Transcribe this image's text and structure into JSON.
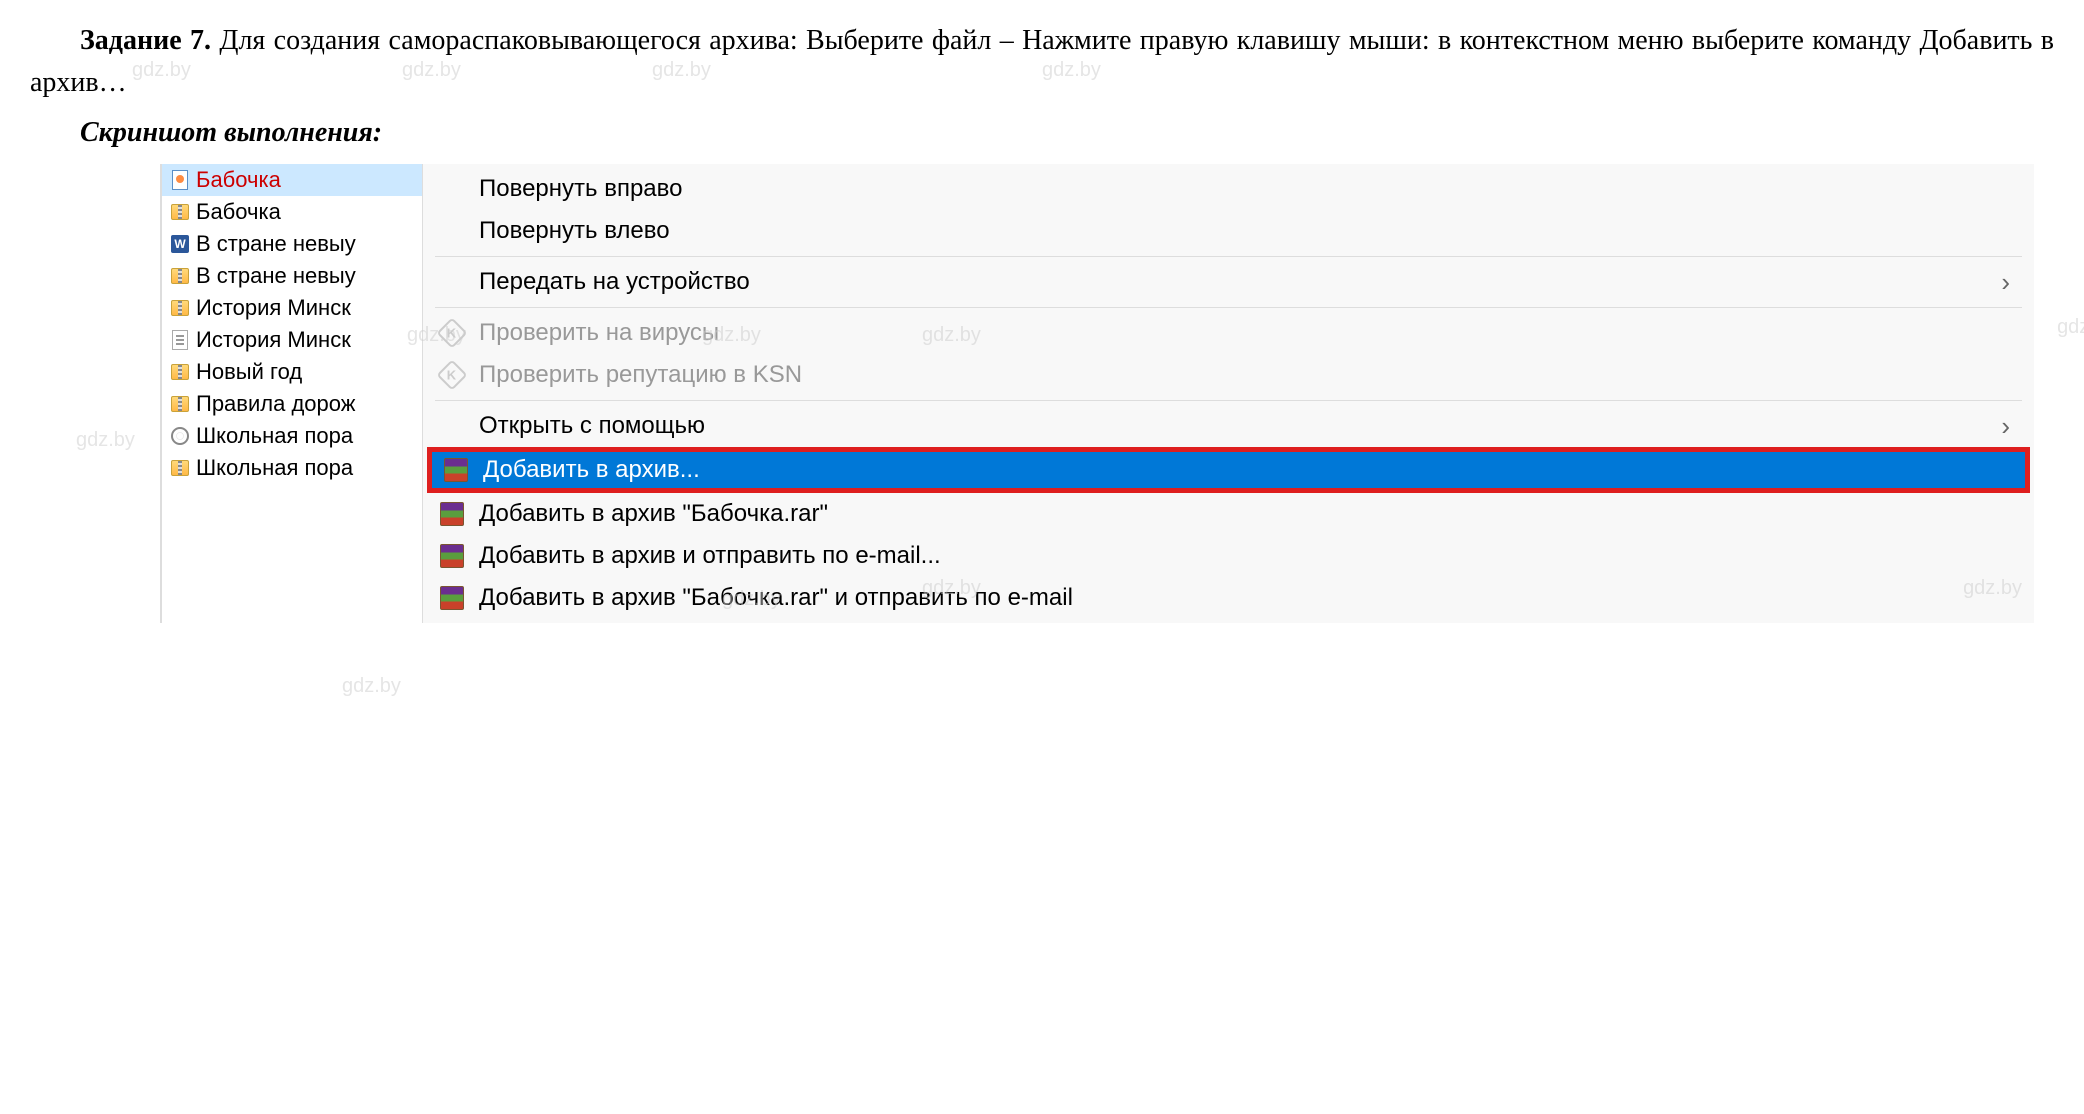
{
  "task": {
    "label": "Задание 7.",
    "text": " Для создания самораспаковывающегося архива: Выберите файл – Нажмите правую клавишу мыши: в контекстном меню выберите команду Добавить в архив…"
  },
  "subtitle": "Скриншот выполнения:",
  "watermark": "gdz.by",
  "files": [
    {
      "name": "Бабочка",
      "icon": "doc-page",
      "selected": true
    },
    {
      "name": "Бабочка",
      "icon": "zip",
      "selected": false
    },
    {
      "name": "В стране невыу",
      "icon": "word",
      "selected": false
    },
    {
      "name": "В стране невыу",
      "icon": "zip",
      "selected": false
    },
    {
      "name": "История Минск",
      "icon": "zip",
      "selected": false
    },
    {
      "name": "История Минск",
      "icon": "text",
      "selected": false
    },
    {
      "name": "Новый год",
      "icon": "zip",
      "selected": false
    },
    {
      "name": "Правила дорож",
      "icon": "zip",
      "selected": false
    },
    {
      "name": "Школьная пора",
      "icon": "disc",
      "selected": false
    },
    {
      "name": "Школьная пора",
      "icon": "zip",
      "selected": false
    }
  ],
  "menu": {
    "rotate_right": "Повернуть вправо",
    "rotate_left": "Повернуть влево",
    "cast": "Передать на устройство",
    "virus_check": "Проверить на вирусы",
    "ksn_check": "Проверить репутацию в KSN",
    "open_with": "Открыть с помощью",
    "add_archive": "Добавить в архив...",
    "add_archive_named": "Добавить в архив \"Бабочка.rar\"",
    "add_email": "Добавить в архив и отправить по e-mail...",
    "add_named_email": "Добавить в архив \"Бабочка.rar\" и отправить по e-mail"
  }
}
